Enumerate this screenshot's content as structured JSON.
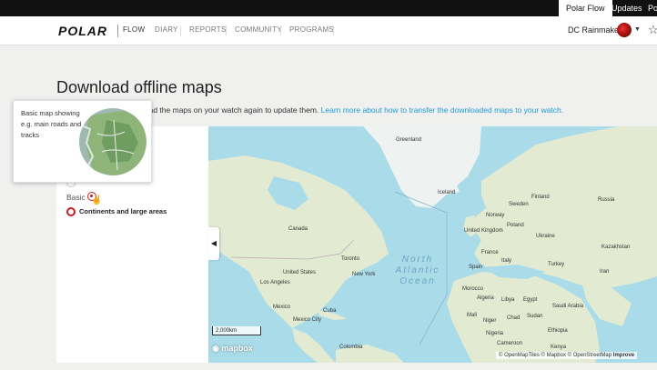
{
  "topbar": {
    "tabs": [
      "Polar Flow",
      "Updates",
      "Po"
    ]
  },
  "nav": {
    "logo": "POLAR",
    "items": [
      "FLOW",
      "DIARY",
      "REPORTS",
      "COMMUNITY",
      "PROGRAMS"
    ],
    "user_name": "DC Rainmaker"
  },
  "page": {
    "title": "Download offline maps",
    "intro_text": "load the maps on your watch again to update them.",
    "intro_link": "Learn more about how to transfer the downloaded maps to your watch."
  },
  "options": {
    "basic_label": "Basic",
    "continents_label": "Continents and large areas"
  },
  "tooltip": {
    "text": "Basic map showing e.g. main roads and tracks"
  },
  "map": {
    "labels": {
      "greenland": "Greenland",
      "iceland": "Iceland",
      "sweden": "Sweden",
      "finland": "Finland",
      "norway": "Norway",
      "russia": "Russia",
      "united_kingdom": "United Kingdom",
      "poland": "Poland",
      "ukraine": "Ukraine",
      "kazakhstan": "Kazakhstan",
      "france": "France",
      "spain": "Spain",
      "italy": "Italy",
      "turkey": "Turkey",
      "iran": "Iran",
      "canada": "Canada",
      "united_states": "United States",
      "toronto": "Toronto",
      "new_york": "New York",
      "los_angeles": "Los Angeles",
      "mexico": "Mexico",
      "mexico_city": "Mexico City",
      "cuba": "Cuba",
      "colombia": "Colombia",
      "morocco": "Morocco",
      "algeria": "Algeria",
      "libya": "Libya",
      "egypt": "Egypt",
      "saudi_arabia": "Saudi Arabia",
      "mali": "Mali",
      "niger": "Niger",
      "chad": "Chad",
      "sudan": "Sudan",
      "nigeria": "Nigeria",
      "ethiopia": "Ethiopia",
      "cameroon": "Cameroon",
      "kenya": "Kenya",
      "ocean": "North Atlantic Ocean"
    },
    "collapse_arrow": "◀",
    "scale": "2,000km",
    "brand": "mapbox",
    "attribution": "© OpenMapTiles © Mapbox © OpenStreetMap",
    "improve": "Improve"
  },
  "colors": {
    "accent": "#1f9ad6",
    "brand_red": "#d10a11",
    "water": "#a9dbe9",
    "land": "#dfe9cf"
  }
}
